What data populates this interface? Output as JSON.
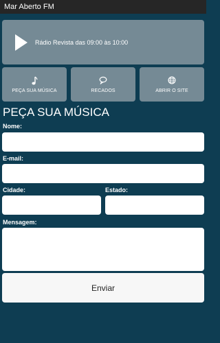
{
  "app": {
    "title": "Mar Aberto FM"
  },
  "player": {
    "now_playing": "Rádio Revista das 09:00 às 10:00",
    "play_icon": "play-icon"
  },
  "nav": {
    "items": [
      {
        "label": "PEÇA SUA MÚSICA",
        "icon": "music-note-icon"
      },
      {
        "label": "RECADOS",
        "icon": "speech-bubble-icon"
      },
      {
        "label": "ABRIR O SITE",
        "icon": "globe-icon"
      }
    ]
  },
  "form": {
    "title": "PEÇA SUA MÚSICA",
    "name_label": "Nome:",
    "email_label": "E-mail:",
    "city_label": "Cidade:",
    "state_label": "Estado:",
    "message_label": "Mensagem:",
    "submit_label": "Enviar"
  },
  "colors": {
    "background": "#0e3d52",
    "panel": "#758a95",
    "titlebar": "#262626"
  }
}
